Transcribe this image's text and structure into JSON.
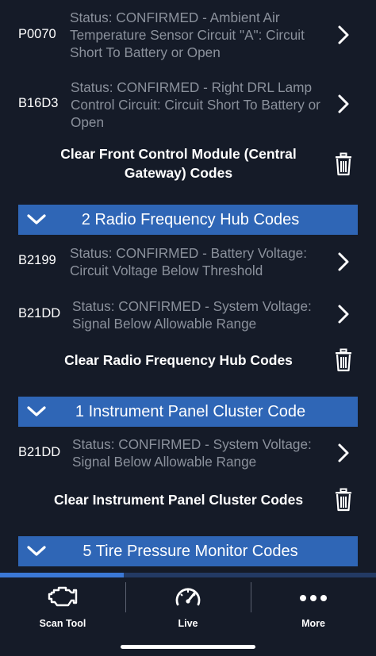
{
  "rows": [
    {
      "code": "P0070",
      "description": "Status: CONFIRMED - Ambient Air Temperature Sensor Circuit \"A\": Circuit Short To Battery or Open"
    },
    {
      "code": "B16D3",
      "description": "Status: CONFIRMED - Right DRL Lamp Control Circuit: Circuit Short To Battery or Open"
    },
    {
      "code": "B2199",
      "description": "Status: CONFIRMED - Battery  Voltage: Circuit Voltage Below Threshold"
    },
    {
      "code": "B21DD",
      "description": "Status: CONFIRMED - System Voltage: Signal Below Allowable Range"
    },
    {
      "code": "B21DD",
      "description": "Status: CONFIRMED - System Voltage: Signal Below Allowable Range"
    }
  ],
  "clear_actions": [
    {
      "label": "Clear Front Control Module (Central Gateway) Codes"
    },
    {
      "label": "Clear Radio Frequency Hub Codes"
    },
    {
      "label": "Clear Instrument Panel Cluster Codes"
    }
  ],
  "sections": [
    {
      "title": "2 Radio Frequency Hub Codes"
    },
    {
      "title": "1 Instrument Panel Cluster Code"
    },
    {
      "title": "5 Tire Pressure Monitor Codes"
    }
  ],
  "tabbar": {
    "progress_fraction": 0.33,
    "tabs": [
      {
        "label": "Scan Tool",
        "icon": "engine-icon"
      },
      {
        "label": "Live",
        "icon": "gauge-icon"
      },
      {
        "label": "More",
        "icon": "more-dots-icon"
      }
    ]
  },
  "colors": {
    "background": "#151b28",
    "section_header": "#2f66b6",
    "description_text": "#8b919c",
    "progress_track": "#233a64",
    "progress_fill": "#3b78d6"
  }
}
